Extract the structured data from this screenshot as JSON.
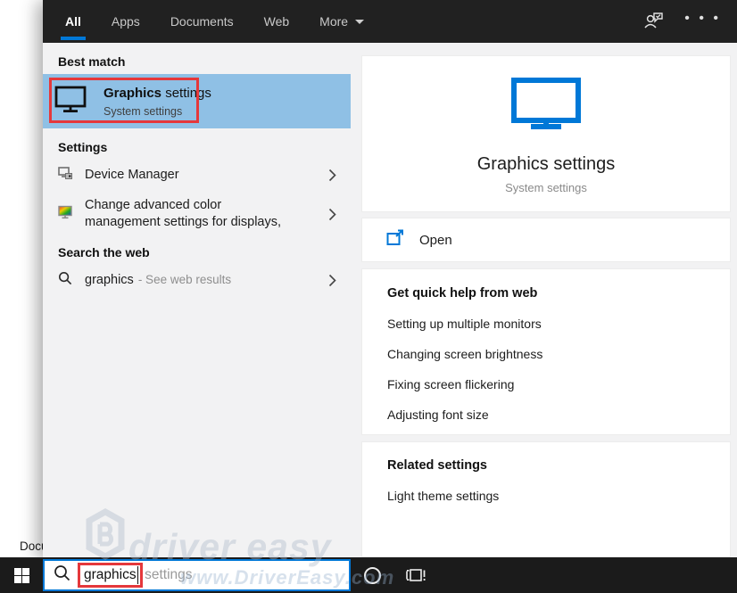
{
  "topbar": {
    "tabs": [
      {
        "label": "All",
        "active": true
      },
      {
        "label": "Apps",
        "active": false
      },
      {
        "label": "Documents",
        "active": false
      },
      {
        "label": "Web",
        "active": false
      },
      {
        "label": "More",
        "active": false,
        "has_dropdown": true
      }
    ],
    "ellipsis_glyph": "• • •"
  },
  "left_panel": {
    "best_match": {
      "header": "Best match",
      "title_bold": "Graphics",
      "title_rest": " settings",
      "subtitle": "System settings"
    },
    "settings_section": {
      "header": "Settings",
      "items": [
        {
          "label": "Device Manager"
        },
        {
          "label": "Change advanced color management settings for displays,"
        }
      ]
    },
    "web_section": {
      "header": "Search the web",
      "query": "graphics",
      "suffix": "- See web results"
    }
  },
  "right_panel": {
    "title": "Graphics settings",
    "subtitle": "System settings",
    "open_label": "Open",
    "help": {
      "header": "Get quick help from web",
      "links": [
        "Setting up multiple monitors",
        "Changing screen brightness",
        "Fixing screen flickering",
        "Adjusting font size"
      ]
    },
    "related": {
      "header": "Related settings",
      "links": [
        "Light theme settings"
      ]
    }
  },
  "taskbar": {
    "search_value": "graphics",
    "search_suggestion": "settings"
  },
  "desktop": {
    "partial_label": "Docu"
  },
  "watermark": {
    "line1": "driver easy",
    "line2": "www.DriverEasy.com"
  },
  "colors": {
    "accent": "#0078d7",
    "highlight": "#8fc0e5",
    "annotation_red": "#e5383b",
    "topbar_bg": "#212121",
    "taskbar_bg": "#1b1b1b"
  }
}
